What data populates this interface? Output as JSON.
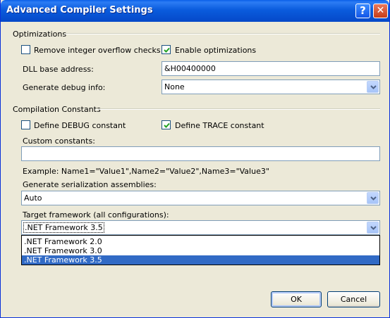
{
  "window": {
    "title": "Advanced Compiler Settings",
    "help_glyph": "?",
    "close_glyph": "✕"
  },
  "optimizations": {
    "group_label": "Optimizations",
    "remove_overflow_label": "Remove integer overflow checks",
    "remove_overflow_checked": false,
    "enable_opt_label": "Enable optimizations",
    "enable_opt_checked": true,
    "dll_base_label": "DLL base address:",
    "dll_base_value": "&H00400000",
    "debug_info_label": "Generate debug info:",
    "debug_info_value": "None"
  },
  "constants": {
    "group_label": "Compilation Constants",
    "debug_label": "Define DEBUG constant",
    "debug_checked": false,
    "trace_label": "Define TRACE constant",
    "trace_checked": true,
    "custom_label": "Custom constants:",
    "custom_value": "",
    "example_text": "Example: Name1=\"Value1\",Name2=\"Value2\",Name3=\"Value3\"",
    "serialization_label": "Generate serialization assemblies:",
    "serialization_value": "Auto",
    "target_label": "Target framework (all configurations):",
    "target_value": ".NET Framework 3.5",
    "target_options": [
      ".NET Framework 2.0",
      ".NET Framework 3.0",
      ".NET Framework 3.5"
    ],
    "target_selected_index": 2
  },
  "buttons": {
    "ok": "OK",
    "cancel": "Cancel"
  },
  "colors": {
    "title_blue": "#0a5cdd",
    "selection_blue": "#316ac5",
    "dialog_bg": "#ece9d8",
    "check_green": "#21a121"
  }
}
